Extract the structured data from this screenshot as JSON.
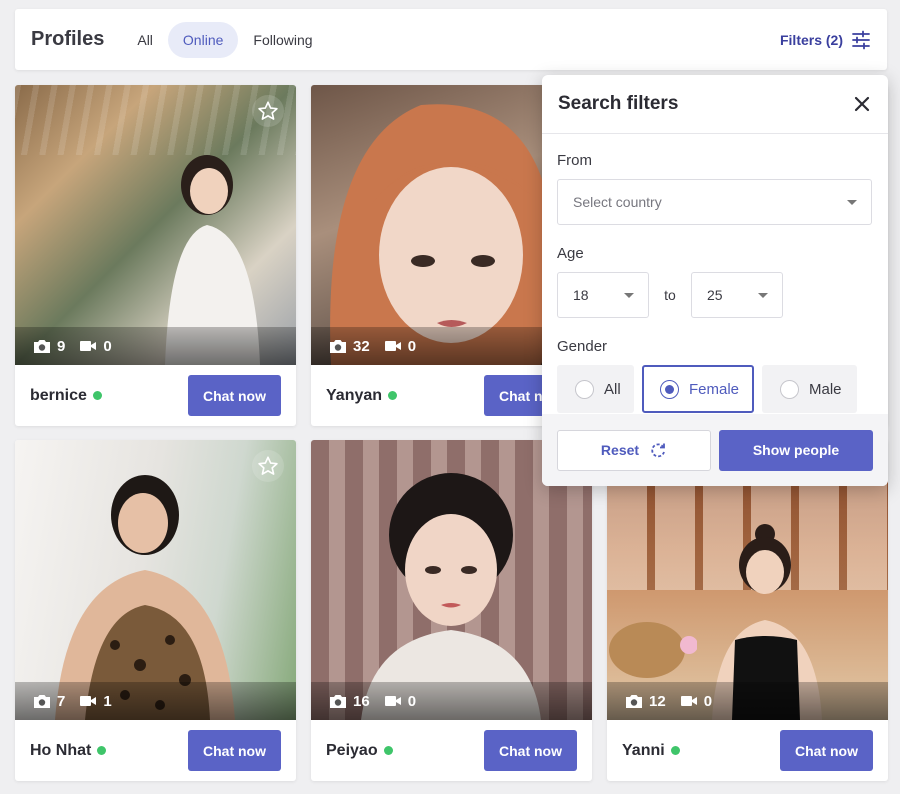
{
  "header": {
    "title": "Profiles",
    "tabs": [
      {
        "label": "All",
        "active": false
      },
      {
        "label": "Online",
        "active": true
      },
      {
        "label": "Following",
        "active": false
      }
    ],
    "filters_label": "Filters (2)",
    "filters_icon": "sliders-icon"
  },
  "profiles": [
    {
      "name": "bernice",
      "photos": "9",
      "videos": "0",
      "online": true,
      "chat_label": "Chat now",
      "has_star": true
    },
    {
      "name": "Yanyan",
      "photos": "32",
      "videos": "0",
      "online": true,
      "chat_label": "Chat now",
      "has_star": false
    },
    {
      "name": "Ho Nhat",
      "photos": "7",
      "videos": "1",
      "online": true,
      "chat_label": "Chat now",
      "has_star": true
    },
    {
      "name": "Peiyao",
      "photos": "16",
      "videos": "0",
      "online": true,
      "chat_label": "Chat now",
      "has_star": false
    },
    {
      "name": "Yanni",
      "photos": "12",
      "videos": "0",
      "online": true,
      "chat_label": "Chat now",
      "has_star": false
    }
  ],
  "filter_panel": {
    "title": "Search filters",
    "from_label": "From",
    "country_placeholder": "Select country",
    "age_label": "Age",
    "age_min": "18",
    "age_to": "to",
    "age_max": "25",
    "gender_label": "Gender",
    "gender_options": [
      {
        "label": "All",
        "selected": false
      },
      {
        "label": "Female",
        "selected": true
      },
      {
        "label": "Male",
        "selected": false
      }
    ],
    "reset_label": "Reset",
    "show_label": "Show people"
  },
  "colors": {
    "accent": "#5a63c6",
    "accent_text": "#4f5bbd",
    "online": "#3fc56a",
    "tab_active_bg": "#e8ebf8"
  }
}
